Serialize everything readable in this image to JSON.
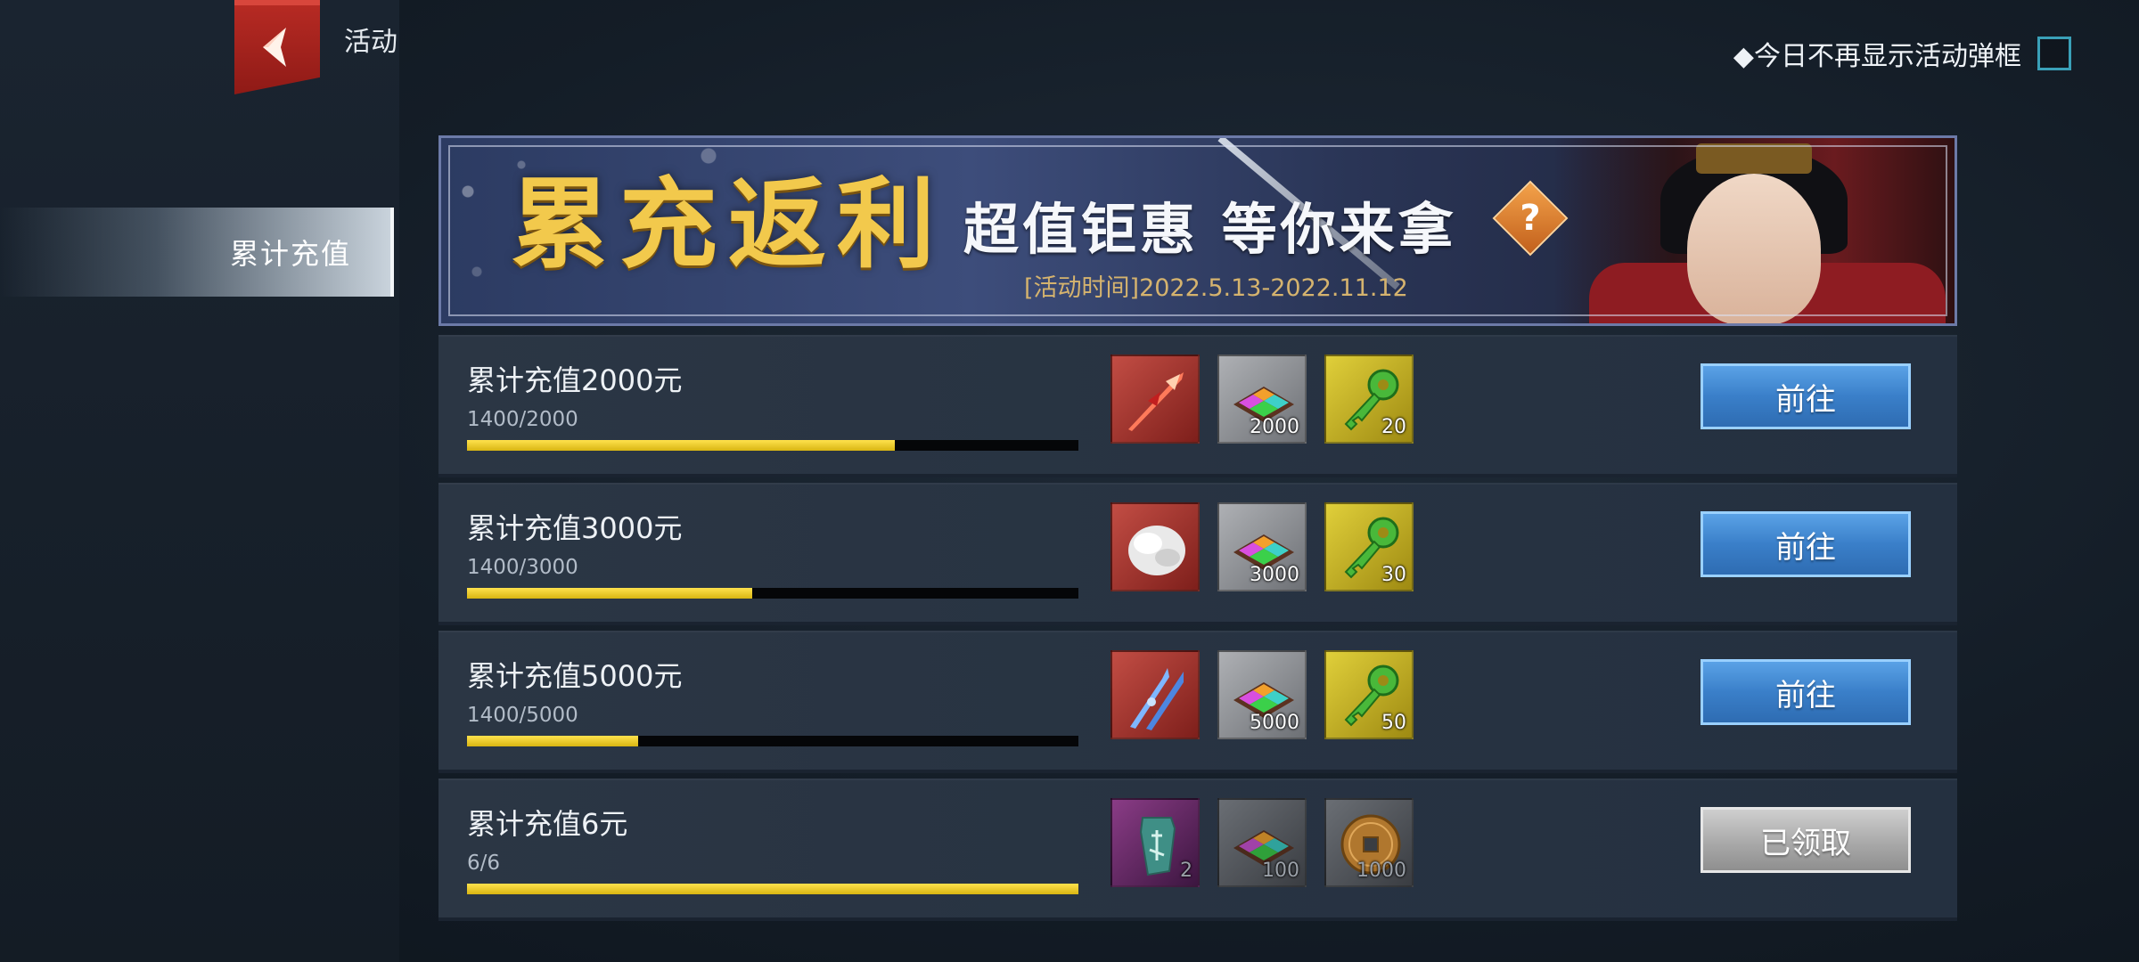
{
  "header": {
    "title": "活动",
    "hide_popup_label": "◆今日不再显示活动弹框"
  },
  "sidebar": {
    "items": [
      {
        "label": "累计充值",
        "selected": true
      }
    ]
  },
  "banner": {
    "title": "累充返利",
    "subtitle": "超值钜惠 等你来拿",
    "help_symbol": "?",
    "date": "[活动时间]2022.5.13-2022.11.12"
  },
  "rows": [
    {
      "title": "累计充值2000元",
      "progress_text": "1400/2000",
      "progress": 0.7,
      "button": "前往",
      "button_state": "active",
      "rewards": [
        {
          "icon": "red-spear-icon",
          "count": ""
        },
        {
          "icon": "gem-box-icon",
          "count": "2000"
        },
        {
          "icon": "green-key-icon",
          "count": "20"
        }
      ]
    },
    {
      "title": "累计充值3000元",
      "progress_text": "1400/3000",
      "progress": 0.4667,
      "button": "前往",
      "button_state": "active",
      "rewards": [
        {
          "icon": "white-fur-icon",
          "count": ""
        },
        {
          "icon": "gem-box-icon",
          "count": "3000"
        },
        {
          "icon": "green-key-icon",
          "count": "30"
        }
      ]
    },
    {
      "title": "累计充值5000元",
      "progress_text": "1400/5000",
      "progress": 0.28,
      "button": "前往",
      "button_state": "active",
      "rewards": [
        {
          "icon": "blue-twin-blades-icon",
          "count": ""
        },
        {
          "icon": "gem-box-icon",
          "count": "5000"
        },
        {
          "icon": "green-key-icon",
          "count": "50"
        }
      ]
    },
    {
      "title": "累计充值6元",
      "progress_text": "6/6",
      "progress": 1.0,
      "button": "已领取",
      "button_state": "claimed",
      "rewards": [
        {
          "icon": "jade-token-icon",
          "count": "2"
        },
        {
          "icon": "gem-box-icon",
          "count": "100"
        },
        {
          "icon": "copper-coin-icon",
          "count": "1000"
        }
      ]
    }
  ],
  "colors": {
    "accent_blue": "#3a7fc9",
    "progress_yellow": "#f0cf2a",
    "back_red": "#b82b24",
    "banner_gold": "#f2c94c"
  }
}
